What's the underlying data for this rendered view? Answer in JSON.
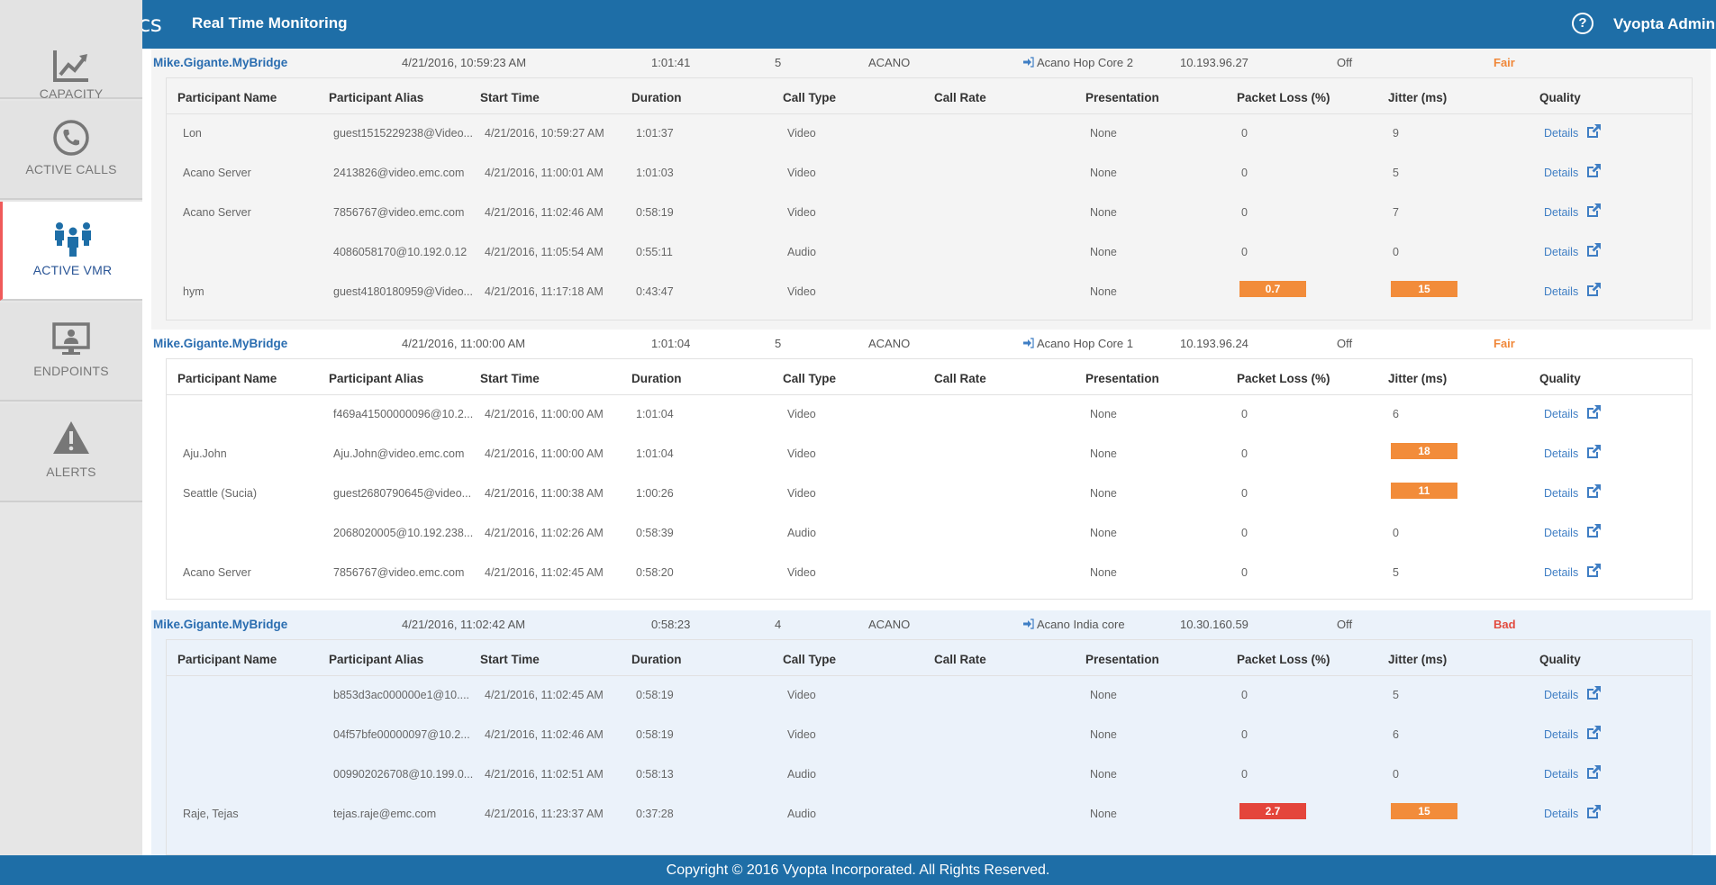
{
  "header": {
    "app_name": "vAnalytics",
    "page_title": "Real Time Monitoring",
    "user_name": "Vyopta Admin",
    "help_glyph": "?"
  },
  "sidebar": {
    "items": [
      {
        "label": "CAPACITY",
        "icon": "capacity-chart-icon",
        "active": false
      },
      {
        "label": "ACTIVE CALLS",
        "icon": "phone-icon",
        "active": false
      },
      {
        "label": "ACTIVE VMR",
        "icon": "people-group-icon",
        "active": true
      },
      {
        "label": "ENDPOINTS",
        "icon": "monitor-user-icon",
        "active": false
      },
      {
        "label": "ALERTS",
        "icon": "warning-icon",
        "active": false
      }
    ]
  },
  "columns": [
    "Participant Name",
    "Participant Alias",
    "Start Time",
    "Duration",
    "Call Type",
    "Call Rate",
    "Presentation",
    "Packet Loss (%)",
    "Jitter (ms)",
    "Quality"
  ],
  "details_label": "Details",
  "colors": {
    "accent": "#1e6ea7",
    "fair": "#f0883a",
    "bad": "#e24b3f",
    "warn_badge": "#f28c3a",
    "bad_badge": "#e4453b"
  },
  "groups": [
    {
      "bridge": "Mike.Gigante.MyBridge",
      "start": "4/21/2016, 10:59:23 AM",
      "duration": "1:01:41",
      "participants": "5",
      "type": "ACANO",
      "host": "Acano Hop Core 2",
      "ip": "10.193.96.27",
      "recording": "Off",
      "quality": "Fair",
      "rows": [
        {
          "name": "Lon",
          "alias": "guest1515229238@Video...",
          "start": "4/21/2016, 10:59:27 AM",
          "duration": "1:01:37",
          "call_type": "Video",
          "call_rate": "",
          "presentation": "None",
          "packet_loss": "0",
          "packet_loss_level": "ok",
          "jitter": "9",
          "jitter_level": "ok"
        },
        {
          "name": "Acano Server",
          "alias": "2413826@video.emc.com",
          "start": "4/21/2016, 11:00:01 AM",
          "duration": "1:01:03",
          "call_type": "Video",
          "call_rate": "",
          "presentation": "None",
          "packet_loss": "0",
          "packet_loss_level": "ok",
          "jitter": "5",
          "jitter_level": "ok"
        },
        {
          "name": "Acano Server",
          "alias": "7856767@video.emc.com",
          "start": "4/21/2016, 11:02:46 AM",
          "duration": "0:58:19",
          "call_type": "Video",
          "call_rate": "",
          "presentation": "None",
          "packet_loss": "0",
          "packet_loss_level": "ok",
          "jitter": "7",
          "jitter_level": "ok"
        },
        {
          "name": "",
          "alias": "4086058170@10.192.0.12",
          "start": "4/21/2016, 11:05:54 AM",
          "duration": "0:55:11",
          "call_type": "Audio",
          "call_rate": "",
          "presentation": "None",
          "packet_loss": "0",
          "packet_loss_level": "ok",
          "jitter": "0",
          "jitter_level": "ok"
        },
        {
          "name": "hym",
          "alias": "guest4180180959@Video...",
          "start": "4/21/2016, 11:17:18 AM",
          "duration": "0:43:47",
          "call_type": "Video",
          "call_rate": "",
          "presentation": "None",
          "packet_loss": "0.7",
          "packet_loss_level": "warn",
          "jitter": "15",
          "jitter_level": "warn"
        }
      ]
    },
    {
      "bridge": "Mike.Gigante.MyBridge",
      "start": "4/21/2016, 11:00:00 AM",
      "duration": "1:01:04",
      "participants": "5",
      "type": "ACANO",
      "host": "Acano Hop Core 1",
      "ip": "10.193.96.24",
      "recording": "Off",
      "quality": "Fair",
      "rows": [
        {
          "name": "",
          "alias": "f469a41500000096@10.2...",
          "start": "4/21/2016, 11:00:00 AM",
          "duration": "1:01:04",
          "call_type": "Video",
          "call_rate": "",
          "presentation": "None",
          "packet_loss": "0",
          "packet_loss_level": "ok",
          "jitter": "6",
          "jitter_level": "ok"
        },
        {
          "name": "Aju.John",
          "alias": "Aju.John@video.emc.com",
          "start": "4/21/2016, 11:00:00 AM",
          "duration": "1:01:04",
          "call_type": "Video",
          "call_rate": "",
          "presentation": "None",
          "packet_loss": "0",
          "packet_loss_level": "ok",
          "jitter": "18",
          "jitter_level": "warn"
        },
        {
          "name": "Seattle (Sucia)",
          "alias": "guest2680790645@video...",
          "start": "4/21/2016, 11:00:38 AM",
          "duration": "1:00:26",
          "call_type": "Video",
          "call_rate": "",
          "presentation": "None",
          "packet_loss": "0",
          "packet_loss_level": "ok",
          "jitter": "11",
          "jitter_level": "warn"
        },
        {
          "name": "",
          "alias": "2068020005@10.192.238...",
          "start": "4/21/2016, 11:02:26 AM",
          "duration": "0:58:39",
          "call_type": "Audio",
          "call_rate": "",
          "presentation": "None",
          "packet_loss": "0",
          "packet_loss_level": "ok",
          "jitter": "0",
          "jitter_level": "ok"
        },
        {
          "name": "Acano Server",
          "alias": "7856767@video.emc.com",
          "start": "4/21/2016, 11:02:45 AM",
          "duration": "0:58:20",
          "call_type": "Video",
          "call_rate": "",
          "presentation": "None",
          "packet_loss": "0",
          "packet_loss_level": "ok",
          "jitter": "5",
          "jitter_level": "ok"
        }
      ]
    },
    {
      "bridge": "Mike.Gigante.MyBridge",
      "start": "4/21/2016, 11:02:42 AM",
      "duration": "0:58:23",
      "participants": "4",
      "type": "ACANO",
      "host": "Acano India core",
      "ip": "10.30.160.59",
      "recording": "Off",
      "quality": "Bad",
      "rows": [
        {
          "name": "",
          "alias": "b853d3ac000000e1@10....",
          "start": "4/21/2016, 11:02:45 AM",
          "duration": "0:58:19",
          "call_type": "Video",
          "call_rate": "",
          "presentation": "None",
          "packet_loss": "0",
          "packet_loss_level": "ok",
          "jitter": "5",
          "jitter_level": "ok"
        },
        {
          "name": "",
          "alias": "04f57bfe00000097@10.2...",
          "start": "4/21/2016, 11:02:46 AM",
          "duration": "0:58:19",
          "call_type": "Video",
          "call_rate": "",
          "presentation": "None",
          "packet_loss": "0",
          "packet_loss_level": "ok",
          "jitter": "6",
          "jitter_level": "ok"
        },
        {
          "name": "",
          "alias": "009902026708@10.199.0...",
          "start": "4/21/2016, 11:02:51 AM",
          "duration": "0:58:13",
          "call_type": "Audio",
          "call_rate": "",
          "presentation": "None",
          "packet_loss": "0",
          "packet_loss_level": "ok",
          "jitter": "0",
          "jitter_level": "ok"
        },
        {
          "name": "Raje, Tejas",
          "alias": "tejas.raje@emc.com",
          "start": "4/21/2016, 11:23:37 AM",
          "duration": "0:37:28",
          "call_type": "Audio",
          "call_rate": "",
          "presentation": "None",
          "packet_loss": "2.7",
          "packet_loss_level": "bad",
          "jitter": "15",
          "jitter_level": "warn"
        }
      ]
    }
  ],
  "footer": {
    "copyright": "Copyright © 2016 Vyopta Incorporated. All Rights Reserved."
  }
}
